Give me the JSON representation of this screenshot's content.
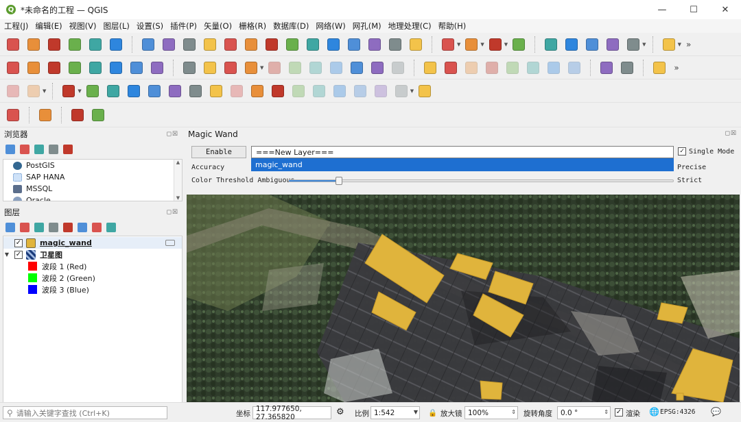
{
  "window": {
    "app_icon": "qgis-logo-icon",
    "title": "*未命名的工程 — QGIS",
    "controls": [
      "minimize-icon",
      "maximize-icon",
      "close-icon"
    ]
  },
  "menu": [
    "工程(J)",
    "编辑(E)",
    "视图(V)",
    "图层(L)",
    "设置(S)",
    "插件(P)",
    "矢量(O)",
    "栅格(R)",
    "数据库(D)",
    "网络(W)",
    "网孔(M)",
    "地理处理(C)",
    "帮助(H)"
  ],
  "toolbars": {
    "overflow_glyph": "»",
    "row1_icons": [
      "new-project-icon",
      "open-project-icon",
      "save-project-icon",
      "save-as-icon",
      "print-layout-icon",
      "style-manager-icon",
      "pan-icon",
      "pan-to-selection-icon",
      "zoom-in-icon",
      "zoom-out-icon",
      "zoom-full-icon",
      "zoom-to-selection-icon",
      "zoom-to-layer-icon",
      "zoom-native-icon",
      "zoom-last-icon",
      "zoom-next-icon",
      "new-bookmark-icon",
      "show-bookmarks-icon",
      "temporal-controller-icon",
      "refresh-icon",
      "select-features-icon",
      "select-by-value-icon",
      "deselect-icon",
      "select-location-icon",
      "identify-icon",
      "attribute-table-icon",
      "processing-toolbox-icon",
      "statistics-icon",
      "map-tips-icon",
      "measure-icon"
    ],
    "row2_icons": [
      "data-source-manager-icon",
      "new-geopackage-layer-icon",
      "new-shapefile-layer-icon",
      "digitize-icon",
      "new-spatialite-layer-icon",
      "new-virtual-layer-icon",
      "virtual-layer-icon",
      "current-edits-icon",
      "toggle-editing-icon",
      "save-edits-icon",
      "add-polygon-icon",
      "vertex-tool-icon",
      "modify-attributes-icon",
      "delete-selected-icon",
      "cut-features-icon",
      "copy-features-icon",
      "paste-features-icon",
      "undo-icon",
      "redo-icon",
      "label-tool-icon",
      "diagram-tool-icon",
      "pin-labels-icon",
      "highlight-labels-icon",
      "show-hide-labels-icon",
      "move-label-icon",
      "rotate-label-icon",
      "change-label-icon",
      "python-console-icon",
      "help-icon",
      "plugin-manager-icon"
    ],
    "row3_icons": [
      "digitize-segment-icon",
      "digitize-curve-icon",
      "add-ring-icon",
      "add-part-icon",
      "fill-ring-icon",
      "delete-ring-icon",
      "delete-part-icon",
      "reshape-icon",
      "offset-curve-icon",
      "reverse-line-icon",
      "split-features-icon",
      "split-parts-icon",
      "merge-features-icon",
      "merge-attributes-icon",
      "rotate-point-icon",
      "simplify-icon",
      "trim-extend-icon",
      "move-feature-icon",
      "rotate-feature-icon",
      "scale-feature-icon"
    ],
    "row4_icons": [
      "magic-wand-icon",
      "compass-icon",
      "zoom-raster-icon",
      "georeferencer-icon"
    ]
  },
  "browser": {
    "title": "浏览器",
    "tools": [
      "add-selected-icon",
      "refresh-icon",
      "filter-icon",
      "collapse-all-icon",
      "info-icon"
    ],
    "items": [
      {
        "label": "PostGIS",
        "icon": "postgis-elephant-icon"
      },
      {
        "label": "SAP HANA",
        "icon": "sap-hana-icon"
      },
      {
        "label": "MSSQL",
        "icon": "mssql-icon"
      },
      {
        "label": "Oracle",
        "icon": "oracle-icon"
      }
    ]
  },
  "layers_panel": {
    "title": "图层",
    "tools": [
      "style-layer-icon",
      "add-group-icon",
      "visibility-icon",
      "filter-legend-icon",
      "expression-filter-icon",
      "expand-all-icon",
      "collapse-all-icon",
      "remove-layer-icon"
    ],
    "layers": [
      {
        "name": "magic_wand",
        "checked": true,
        "icon": "polygon-layer-icon",
        "selected": true
      },
      {
        "name": "卫星图",
        "checked": true,
        "icon": "raster-layer-icon",
        "expanded": true,
        "bands": [
          {
            "label": "波段 1 (Red)",
            "color": "#ff0000"
          },
          {
            "label": "波段 2 (Green)",
            "color": "#00ff00"
          },
          {
            "label": "波段 3 (Blue)",
            "color": "#0000ff"
          }
        ]
      }
    ]
  },
  "magic_wand": {
    "title": "Magic Wand",
    "enable_label": "Enable",
    "layer_combo_value": "===New Layer===",
    "dropdown_option": "magic_wand",
    "single_mode_label": "Single Mode",
    "single_mode_checked": true,
    "accuracy_label": "Accuracy",
    "precise_label": "Precise",
    "threshold_label": "Color Threshold Ambiguous",
    "strict_label": "Strict",
    "threshold_value": 0.13
  },
  "statusbar": {
    "search_placeholder": "请输入关键字查找 (Ctrl+K)",
    "coord_label": "坐标",
    "coord_value": "117.977650, 27.365820",
    "scale_label": "比例",
    "scale_value": "1:542",
    "magnifier_label": "放大镜",
    "magnifier_value": "100%",
    "rotation_label": "旋转角度",
    "rotation_value": "0.0 °",
    "render_label": "渲染",
    "render_checked": true,
    "crs_value": "EPSG:4326",
    "icons": [
      "coordinate-toggle-icon",
      "lock-icon",
      "crs-globe-icon",
      "messages-icon"
    ]
  },
  "colors": {
    "accent": "#1e6fd1",
    "polygon_fill": "#e0b43c",
    "polygon_stroke": "#d4a02c"
  }
}
